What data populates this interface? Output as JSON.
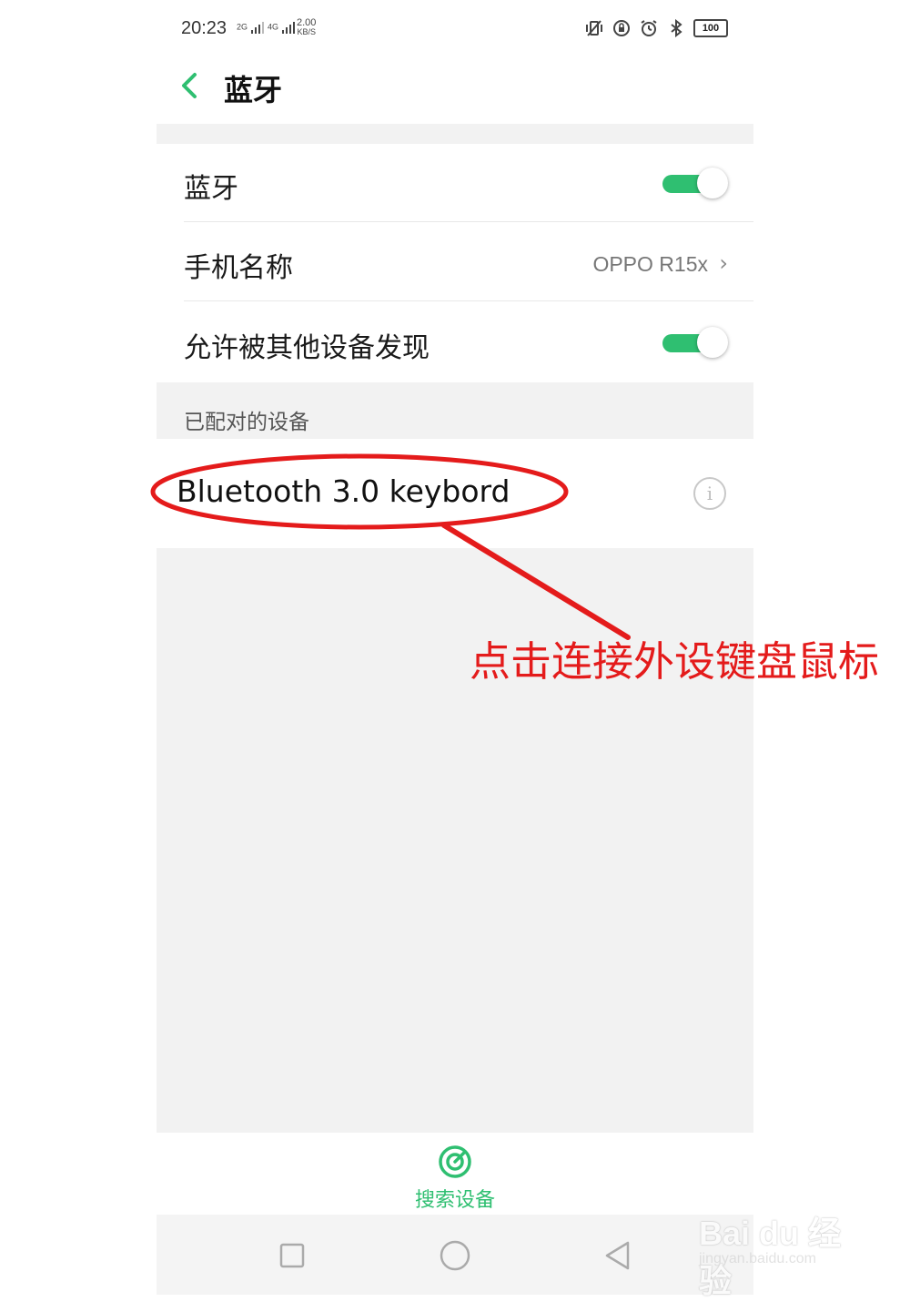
{
  "status_bar": {
    "time": "20:23",
    "sim1": "2G",
    "sim2": "4G",
    "speed_value": "2.00",
    "speed_unit": "KB/S",
    "battery": "100"
  },
  "header": {
    "title": "蓝牙"
  },
  "settings": [
    {
      "label": "蓝牙",
      "type": "toggle",
      "on": true
    },
    {
      "label": "手机名称",
      "type": "value",
      "value": "OPPO R15x"
    },
    {
      "label": "允许被其他设备发现",
      "type": "toggle",
      "on": true
    }
  ],
  "paired_section": {
    "title": "已配对的设备"
  },
  "paired_devices": [
    {
      "name": "Bluetooth 3.0 keybord"
    }
  ],
  "scan_button": {
    "label": "搜索设备"
  },
  "annotation": {
    "text": "点击连接外设键盘鼠标",
    "color": "#e41b1b"
  },
  "watermark": {
    "brand": "Bai du 经验",
    "url": "jingyan.baidu.com"
  },
  "colors": {
    "accent": "#2fbf71",
    "background": "#f2f2f2"
  }
}
